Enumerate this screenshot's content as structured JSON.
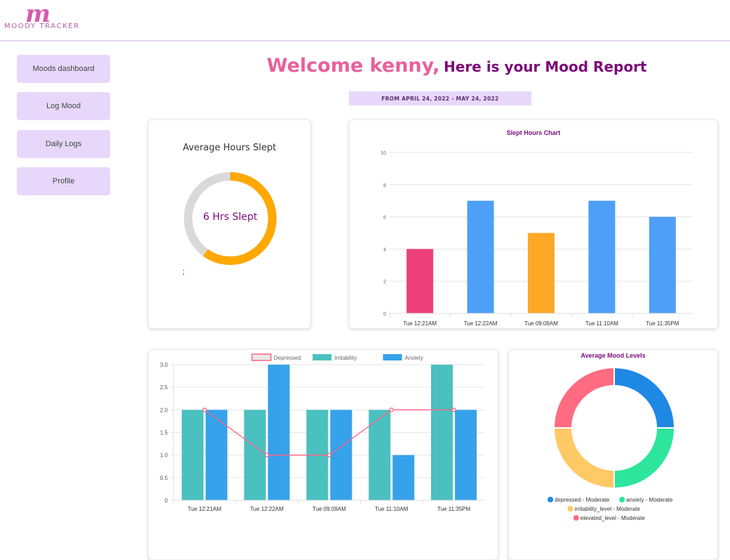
{
  "brand": {
    "logo_letter": "m",
    "name": "MOODY TRACKER"
  },
  "nav": {
    "items": [
      {
        "label": "Moods dashboard"
      },
      {
        "label": "Log Mood"
      },
      {
        "label": "Daily Logs"
      },
      {
        "label": "Profile"
      }
    ]
  },
  "header": {
    "welcome": "Welcome kenny,",
    "subtitle": "Here is your Mood Report",
    "date_range": "FROM APRIL 24, 2022 - MAY 24, 2022"
  },
  "sleep_card": {
    "title": "Average Hours Slept",
    "center_label": "6 Hrs Slept",
    "footnote": ";",
    "value": 6,
    "max": 10
  },
  "colors": {
    "pink": "#ec407a",
    "blue": "#4d9ff7",
    "orange": "#ffa726",
    "teal": "#4bc0c0",
    "brand_purple": "#7b0a7a",
    "nav_bg": "#e7d8fb"
  },
  "chart_data": [
    {
      "type": "bar",
      "title": "Slept Hours Chart",
      "categories": [
        "Tue 12:21AM",
        "Tue 12:22AM",
        "Tue 09:09AM",
        "Tue 11:10AM",
        "Tue 11:35PM"
      ],
      "values": [
        4,
        7,
        5,
        7,
        6
      ],
      "bar_colors": [
        "#ec407a",
        "#4d9ff7",
        "#ffa726",
        "#4d9ff7",
        "#4d9ff7"
      ],
      "ylim": [
        0,
        10
      ],
      "yticks": [
        0,
        2,
        4,
        6,
        8,
        10
      ],
      "grid": true
    },
    {
      "type": "bar",
      "categories": [
        "Tue 12:21AM",
        "Tue 12:22AM",
        "Tue 09:09AM",
        "Tue 11:10AM",
        "Tue 11:35PM"
      ],
      "series": [
        {
          "name": "Depressed",
          "type": "line",
          "values": [
            2,
            1,
            1,
            2,
            2
          ],
          "color": "#ff6384"
        },
        {
          "name": "Irritability",
          "type": "bar",
          "values": [
            2,
            2,
            2,
            2,
            3
          ],
          "color": "#4bc0c0"
        },
        {
          "name": "Anxiety",
          "type": "bar",
          "values": [
            2,
            3,
            2,
            1,
            2
          ],
          "color": "#36a2eb"
        }
      ],
      "ylim": [
        0,
        3
      ],
      "yticks": [
        "0",
        "0.5",
        "1.0",
        "1.5",
        "2.0",
        "2.5",
        "3.0"
      ],
      "legend": "top",
      "grid": true
    },
    {
      "type": "pie",
      "title": "Average Mood Levels",
      "labels": [
        "depressed - Moderate",
        "anxiety - Moderate",
        "irritability_level - Moderate",
        "elevated_level - Moderate"
      ],
      "values": [
        1,
        1,
        1,
        1
      ],
      "colors": [
        "#1e88e5",
        "#2ee59d",
        "#ffc966",
        "#ff6b81"
      ],
      "legend": "bottom"
    }
  ]
}
